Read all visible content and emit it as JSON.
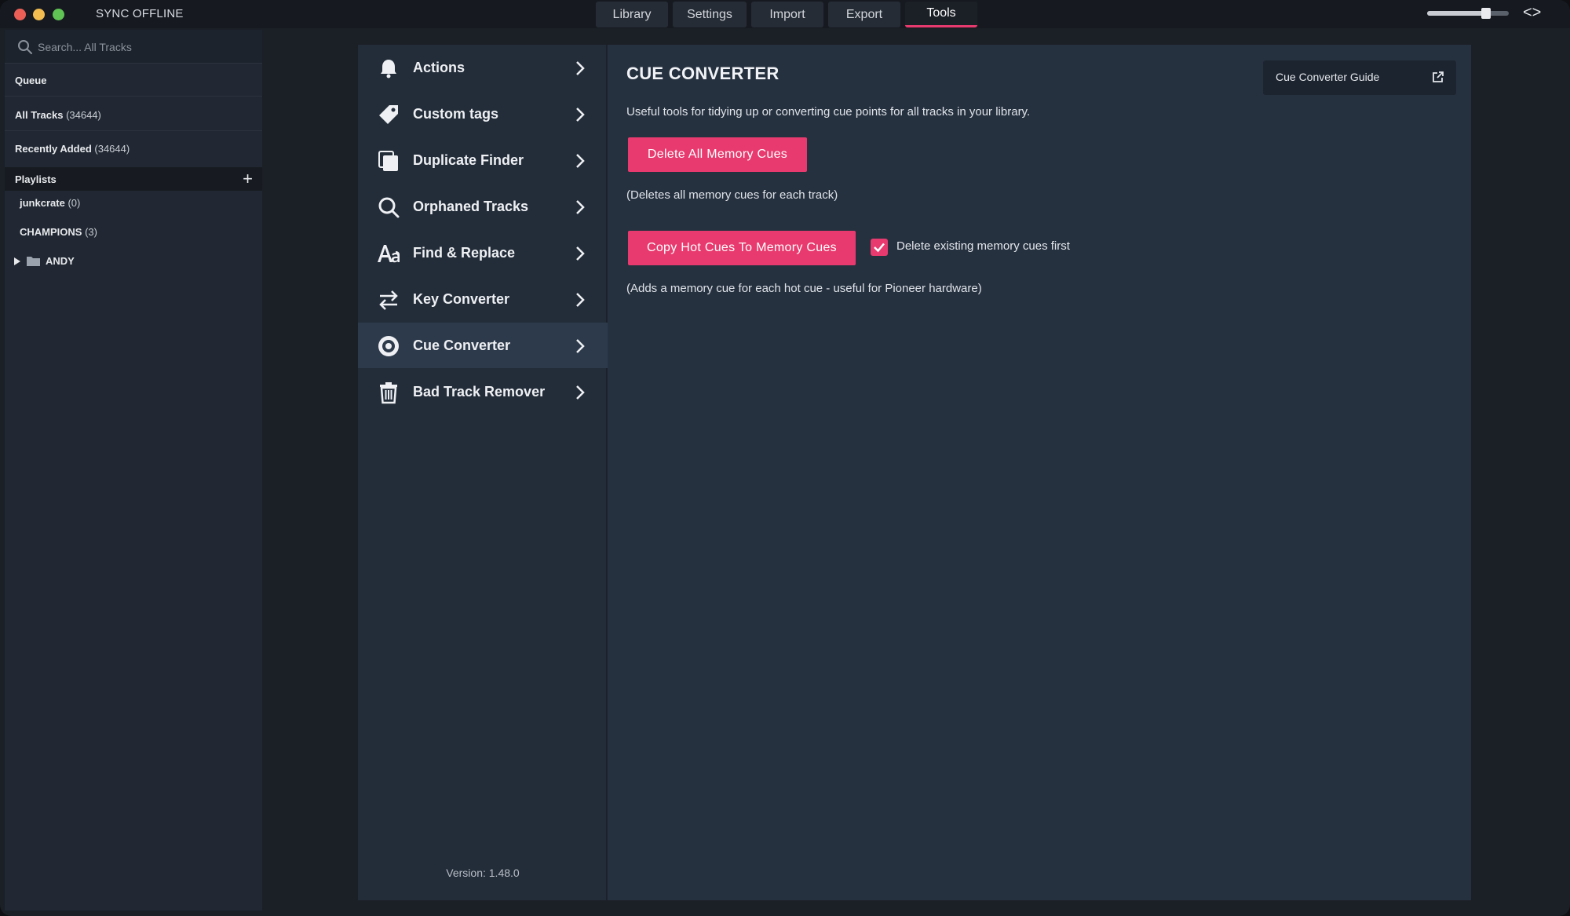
{
  "titlebar": {
    "sync_status": "SYNC OFFLINE",
    "tabs": [
      {
        "label": "Library",
        "active": false
      },
      {
        "label": "Settings",
        "active": false
      },
      {
        "label": "Import",
        "active": false
      },
      {
        "label": "Export",
        "active": false
      },
      {
        "label": "Tools",
        "active": true
      }
    ],
    "zoom_level": 0.72,
    "nav_arrows": "<>"
  },
  "sidebar": {
    "search": {
      "placeholder": "Search... All Tracks",
      "value": ""
    },
    "queue": "Queue",
    "all_tracks": {
      "label": "All Tracks",
      "count": "(34644)"
    },
    "recently_added": {
      "label": "Recently Added",
      "count": "(34644)"
    },
    "playlists_label": "Playlists",
    "add_icon": "+",
    "playlists": [
      {
        "label": "junkcrate",
        "count": "(0)"
      },
      {
        "label": "CHAMPIONS",
        "count": "(3)"
      }
    ],
    "folder": {
      "label": "ANDY",
      "expanded": false
    }
  },
  "tools_menu": {
    "items": [
      {
        "label": "Actions",
        "icon": "bell-icon"
      },
      {
        "label": "Custom tags",
        "icon": "tag-icon"
      },
      {
        "label": "Duplicate Finder",
        "icon": "duplicate-icon"
      },
      {
        "label": "Orphaned Tracks",
        "icon": "search-icon"
      },
      {
        "label": "Find & Replace",
        "icon": "font-icon"
      },
      {
        "label": "Key Converter",
        "icon": "swap-arrows-icon"
      },
      {
        "label": "Cue Converter",
        "icon": "target-icon",
        "active": true
      },
      {
        "label": "Bad Track Remover",
        "icon": "trash-icon"
      }
    ],
    "version": "Version: 1.48.0"
  },
  "content": {
    "title": "CUE CONVERTER",
    "guide_button": "Cue Converter Guide",
    "description": "Useful tools for tidying up or converting cue points for all tracks in your library.",
    "delete_button": "Delete All Memory Cues",
    "delete_note": "(Deletes all memory cues for each track)",
    "copy_button": "Copy Hot Cues To Memory Cues",
    "checkbox_label": "Delete existing memory cues first",
    "checkbox_checked": true,
    "copy_note": "(Adds a memory cue for each hot cue - useful for Pioneer hardware)"
  },
  "colors": {
    "accent": "#e83a6e",
    "panel": "#263140",
    "sidebar": "#212833",
    "background": "#1b1f26"
  }
}
